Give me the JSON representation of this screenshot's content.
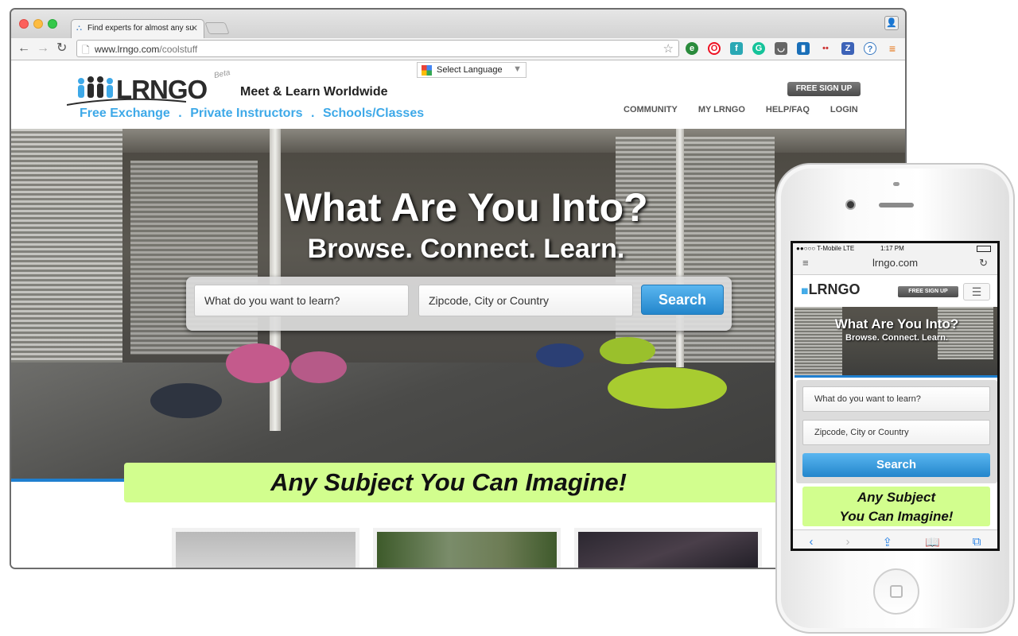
{
  "browser": {
    "tab_title": "Find experts for almost any su",
    "url_host": "www.lrngo.com",
    "url_path": "/coolstuff",
    "extensions": [
      "evernote-icon",
      "opera-icon",
      "feedly-icon",
      "grammarly-icon",
      "pocket-icon",
      "bookmark-icon",
      "dots-icon",
      "zotero-icon",
      "help-icon",
      "menu-icon"
    ]
  },
  "site": {
    "language_selector": "Select Language",
    "logo_text": "LRNGO",
    "beta": "Beta",
    "tagline": "Meet & Learn Worldwide",
    "links": [
      "Free Exchange",
      ".",
      "Private Instructors",
      ".",
      "Schools/Classes"
    ],
    "signup": "FREE SIGN UP",
    "nav": [
      "COMMUNITY",
      "MY LRNGO",
      "HELP/FAQ",
      "LOGIN"
    ],
    "hero_title": "What Are You Into?",
    "hero_subtitle": "Browse. Connect. Learn.",
    "search_subject_placeholder": "What do you want to learn?",
    "search_location_placeholder": "Zipcode, City or Country",
    "search_button": "Search",
    "banner": "Any Subject You Can Imagine!"
  },
  "phone": {
    "carrier": "●●○○○ T-Mobile  LTE",
    "time": "1:17 PM",
    "url": "lrngo.com",
    "logo_text": "LRNGO",
    "signup": "FREE SIGN UP",
    "hero_title": "What Are You Into?",
    "hero_subtitle": "Browse. Connect. Learn.",
    "search_subject_placeholder": "What do you want to learn?",
    "search_location_placeholder": "Zipcode, City or Country",
    "search_button": "Search",
    "banner_line1": "Any Subject",
    "banner_line2": "You Can Imagine!"
  },
  "colors": {
    "accent_blue": "#3ea9e8",
    "banner_green": "#d2fe8e",
    "search_button": "#2386cc"
  }
}
